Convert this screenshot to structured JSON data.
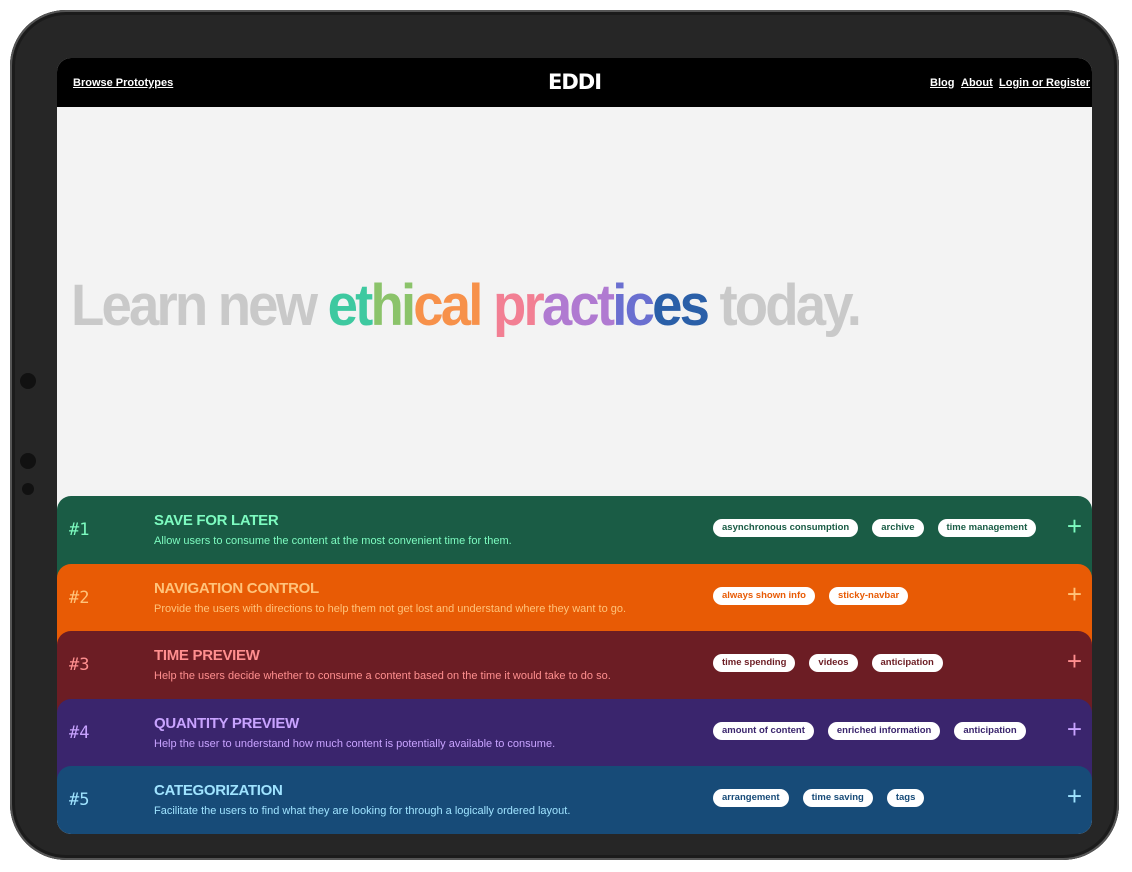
{
  "nav": {
    "browse": "Browse Prototypes",
    "logo": "EDDI",
    "links": [
      "Blog",
      "About",
      "Login or Register"
    ]
  },
  "hero": {
    "prefix": "Learn new ",
    "highlight": "ethical practices",
    "suffix": " today."
  },
  "colors": {
    "gradient": [
      "#3ec9a0",
      "#8bc36a",
      "#f7914a",
      "#f27f93",
      "#b07ad1",
      "#6a6fd0",
      "#2a5fa8"
    ]
  },
  "cards": [
    {
      "num": "#1",
      "title": "SAVE FOR LATER",
      "desc": "Allow users to consume the content at the most convenient time for them.",
      "tags": [
        "asynchronous consumption",
        "archive",
        "time management"
      ],
      "bg": "#1a5c45",
      "fg": "#7dfbc0",
      "tagfg": "#1a5c45"
    },
    {
      "num": "#2",
      "title": "NAVIGATION CONTROL",
      "desc": "Provide the users with directions to help them not get lost and understand where they want to go.",
      "tags": [
        "always shown info",
        "sticky-navbar"
      ],
      "bg": "#e85b05",
      "fg": "#ffc37a",
      "tagfg": "#e85b05"
    },
    {
      "num": "#3",
      "title": "TIME PREVIEW",
      "desc": "Help the users decide whether to consume a content based on the time it would take to do so.",
      "tags": [
        "time spending",
        "videos",
        "anticipation"
      ],
      "bg": "#6c1d24",
      "fg": "#ff8f8f",
      "tagfg": "#6c1d24"
    },
    {
      "num": "#4",
      "title": "QUANTITY PREVIEW",
      "desc": "Help the user to understand how much content is potentially available to consume.",
      "tags": [
        "amount of content",
        "enriched information",
        "anticipation"
      ],
      "bg": "#3a256d",
      "fg": "#c8a3ff",
      "tagfg": "#3a256d"
    },
    {
      "num": "#5",
      "title": "CATEGORIZATION",
      "desc": "Facilitate the users to find what they are looking for through a logically ordered layout.",
      "tags": [
        "arrangement",
        "time saving",
        "tags"
      ],
      "bg": "#174b78",
      "fg": "#9fe3ff",
      "tagfg": "#174b78"
    }
  ],
  "plus_icon": "plus-icon"
}
